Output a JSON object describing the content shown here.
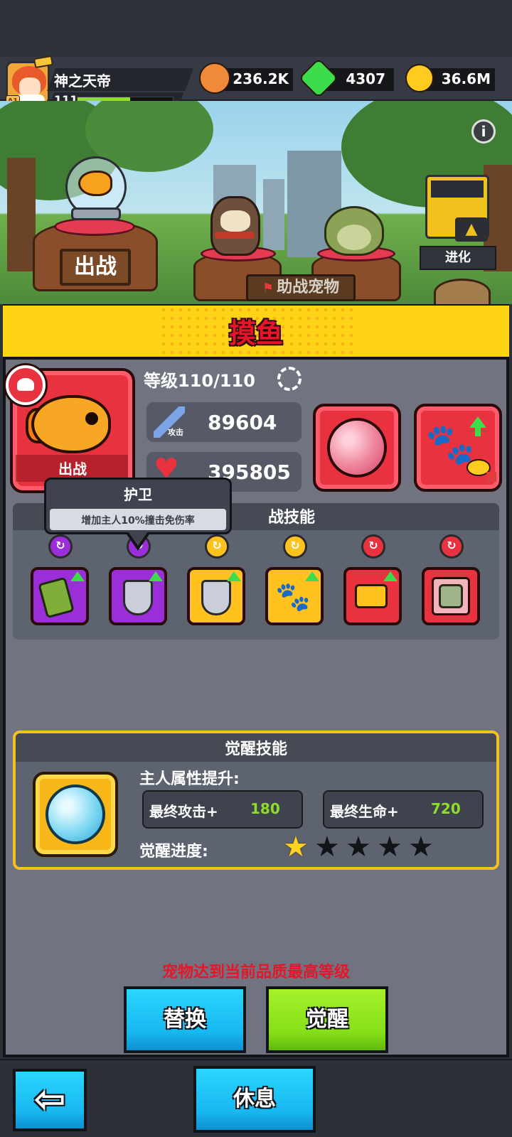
{
  "player": {
    "name": "神之天帝",
    "level": "111",
    "rank_badge": "A1",
    "xp_fraction": 0.55
  },
  "resources": [
    {
      "icon": "dog-coin-icon",
      "value": "236.2K",
      "color": "#f08a3a"
    },
    {
      "icon": "green-gem-icon",
      "value": "4307",
      "color": "#3ddc4a"
    },
    {
      "icon": "gold-coin-icon",
      "value": "36.6M",
      "color": "#ffcb1f"
    }
  ],
  "scene": {
    "deploy_sign": "出战",
    "assist_label": "助战宠物",
    "evolve_label": "进化"
  },
  "pet": {
    "name": "摸鱼",
    "status_label": "出战",
    "level_text": "等级110/110",
    "attack_sub": "攻击",
    "attack_value": "89604",
    "hp_sub": "生命",
    "hp_value": "395805"
  },
  "tooltip": {
    "title": "护卫",
    "description": "增加主人10%撞击免伤率"
  },
  "skills": {
    "title": "战技能",
    "items": [
      {
        "name": "cards-skill",
        "color": "#9b2ed8",
        "ring": "#9b2ed8"
      },
      {
        "name": "shield-skill",
        "color": "#9b2ed8",
        "ring": "#9b2ed8"
      },
      {
        "name": "lock-shield-skill",
        "color": "#ffc21f",
        "ring": "#ffc21f"
      },
      {
        "name": "paw-skill",
        "color": "#ffc21f",
        "ring": "#ffc21f"
      },
      {
        "name": "chest-skill",
        "color": "#e8323f",
        "ring": "#e8323f"
      },
      {
        "name": "zombie-skill",
        "color": "#e8323f",
        "ring": "#e8323f"
      }
    ]
  },
  "awaken": {
    "title": "觉醒技能",
    "attr_title": "主人属性提升:",
    "final_attack_label": "最终攻击+",
    "final_attack_value": "180",
    "final_hp_label": "最终生命+",
    "final_hp_value": "720",
    "progress_label": "觉醒进度:",
    "stars_filled": 1,
    "stars_total": 5
  },
  "messages": {
    "max_level": "宠物达到当前品质最高等级"
  },
  "buttons": {
    "replace": "替换",
    "awaken": "觉醒",
    "back": "⇦",
    "rest": "休息"
  }
}
